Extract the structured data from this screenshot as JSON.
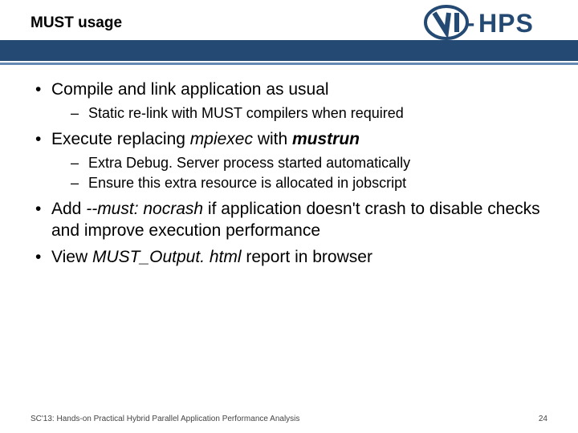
{
  "header": {
    "title": "MUST usage",
    "logo_text": "VI-HPS"
  },
  "bullets": [
    {
      "parts": [
        {
          "t": "Compile and link application as usual"
        }
      ],
      "sub": [
        {
          "parts": [
            {
              "t": "Static re-link with MUST compilers when required"
            }
          ]
        }
      ]
    },
    {
      "parts": [
        {
          "t": "Execute replacing "
        },
        {
          "t": "mpiexec",
          "cls": "it"
        },
        {
          "t": " with "
        },
        {
          "t": "mustrun",
          "cls": "bi"
        }
      ],
      "sub": [
        {
          "parts": [
            {
              "t": "Extra Debug. Server process started automatically"
            }
          ]
        },
        {
          "parts": [
            {
              "t": "Ensure this extra resource is allocated in jobscript"
            }
          ]
        }
      ]
    },
    {
      "parts": [
        {
          "t": "Add "
        },
        {
          "t": "--must: nocrash",
          "cls": "it"
        },
        {
          "t": " if application doesn't crash to disable checks and improve execution performance"
        }
      ]
    },
    {
      "parts": [
        {
          "t": "View "
        },
        {
          "t": "MUST_Output. html",
          "cls": "it"
        },
        {
          "t": " report in browser"
        }
      ]
    }
  ],
  "footer": {
    "left": "SC'13: Hands-on Practical Hybrid Parallel Application Performance Analysis",
    "right": "24"
  }
}
